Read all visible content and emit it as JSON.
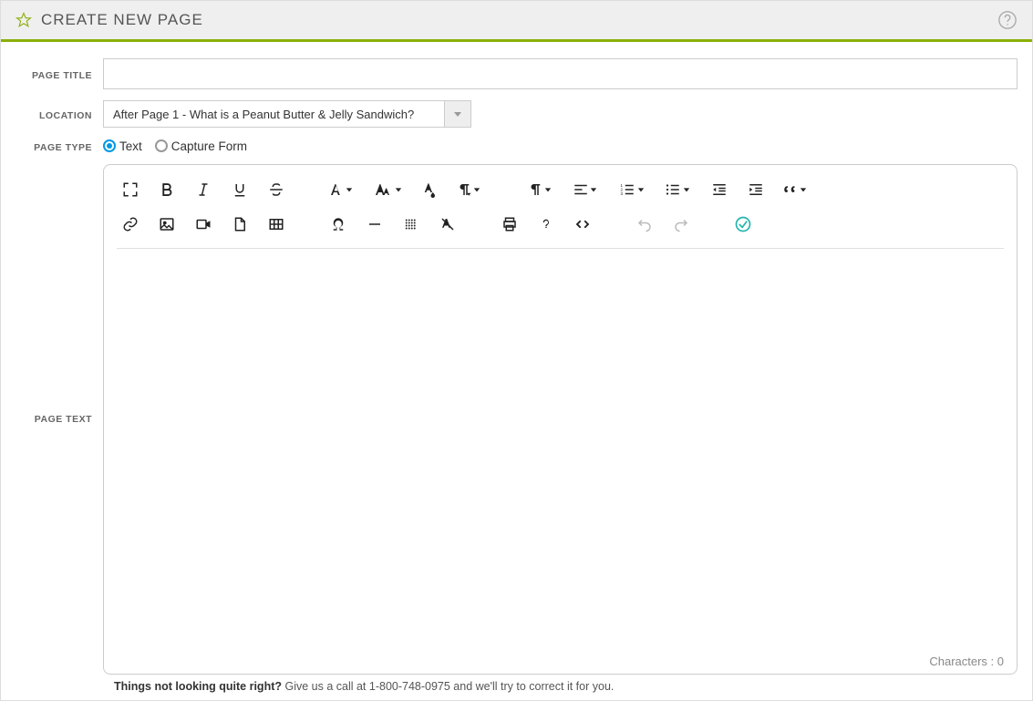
{
  "header": {
    "title": "CREATE NEW PAGE"
  },
  "form": {
    "page_title_label": "PAGE TITLE",
    "page_title_value": "",
    "location_label": "LOCATION",
    "location_selected": "After Page 1 - What is a Peanut Butter & Jelly Sandwich?",
    "page_type_label": "PAGE TYPE",
    "page_type_options": {
      "text": "Text",
      "capture_form": "Capture Form"
    },
    "page_type_selected": "text",
    "page_text_label": "PAGE TEXT"
  },
  "editor": {
    "char_label": "Characters : ",
    "char_count": "0"
  },
  "footer": {
    "bold": "Things not looking quite right?",
    "rest": " Give us a call at 1-800-748-0975 and we'll try to correct it for you."
  }
}
